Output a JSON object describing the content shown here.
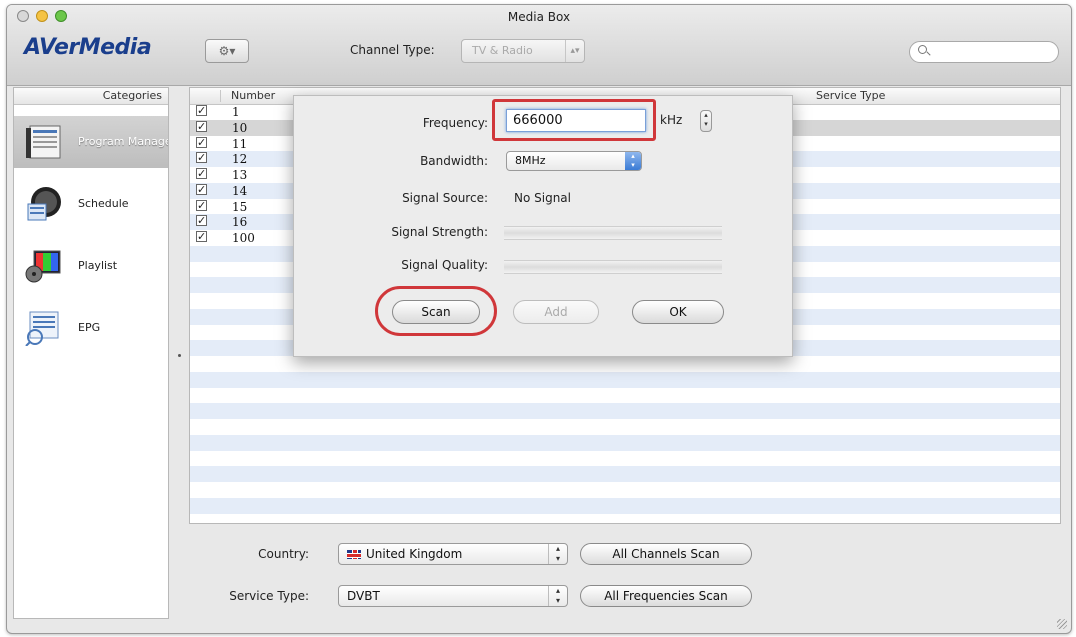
{
  "window": {
    "title": "Media Box"
  },
  "toolbar": {
    "logo": "AVerMedia",
    "gear_glyph": "⚙▾",
    "channel_type_label": "Channel Type:",
    "channel_type_value": "TV & Radio"
  },
  "sidebar": {
    "header": "Categories",
    "items": [
      {
        "label": "Program Manager",
        "icon": "program-manager-icon"
      },
      {
        "label": "Schedule",
        "icon": "schedule-icon"
      },
      {
        "label": "Playlist",
        "icon": "playlist-icon"
      },
      {
        "label": "EPG",
        "icon": "epg-icon"
      }
    ]
  },
  "table": {
    "columns": [
      "Number",
      "Service Type"
    ],
    "rows": [
      {
        "number": "1",
        "checked": true
      },
      {
        "number": "10",
        "checked": true
      },
      {
        "number": "11",
        "checked": true
      },
      {
        "number": "12",
        "checked": true
      },
      {
        "number": "13",
        "checked": true
      },
      {
        "number": "14",
        "checked": true
      },
      {
        "number": "15",
        "checked": true
      },
      {
        "number": "16",
        "checked": true
      },
      {
        "number": "100",
        "checked": true
      }
    ]
  },
  "dialog": {
    "frequency_label": "Frequency:",
    "frequency_value": "666000",
    "frequency_unit": "kHz",
    "bandwidth_label": "Bandwidth:",
    "bandwidth_value": "8MHz",
    "signal_source_label": "Signal Source:",
    "signal_source_value": "No Signal",
    "signal_strength_label": "Signal Strength:",
    "signal_strength_level": 0,
    "signal_quality_label": "Signal Quality:",
    "signal_quality_level": 0,
    "scan_button": "Scan",
    "add_button": "Add",
    "ok_button": "OK"
  },
  "bottom": {
    "country_label": "Country:",
    "country_value": "United Kingdom",
    "all_channels_scan": "All Channels Scan",
    "service_type_label": "Service Type:",
    "service_type_value": "DVBT",
    "all_frequencies_scan": "All Frequencies Scan"
  },
  "colors": {
    "highlight_annotation": "#d0373a",
    "logo": "#1a3e8c",
    "row_stripe": "#e4ecf8"
  }
}
